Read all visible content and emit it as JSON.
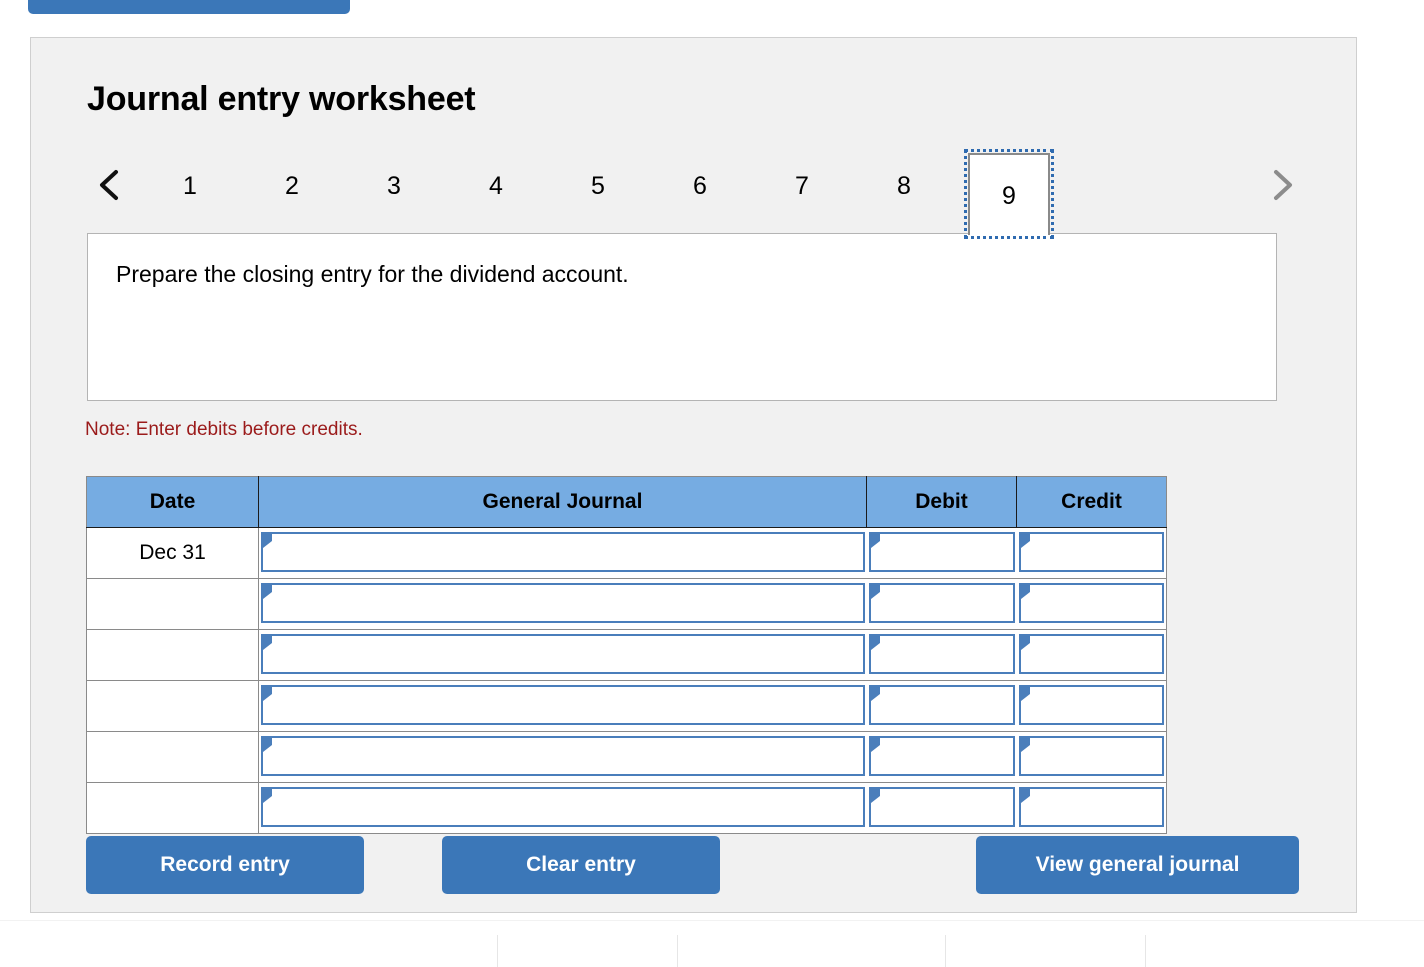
{
  "top_partial_button": {
    "name": "partial-blue-button",
    "color": "#3b77b8"
  },
  "worksheet": {
    "title": "Journal entry worksheet",
    "background": "#f1f1f1",
    "tabs": {
      "prev_icon": "chevron-left-icon",
      "next_icon": "chevron-right-icon",
      "prev_enabled": true,
      "next_enabled": false,
      "items": [
        {
          "label": "1",
          "selected": false
        },
        {
          "label": "2",
          "selected": false
        },
        {
          "label": "3",
          "selected": false
        },
        {
          "label": "4",
          "selected": false
        },
        {
          "label": "5",
          "selected": false
        },
        {
          "label": "6",
          "selected": false
        },
        {
          "label": "7",
          "selected": false
        },
        {
          "label": "8",
          "selected": false
        },
        {
          "label": "9",
          "selected": true
        }
      ],
      "selected_label": "9"
    },
    "instruction": "Prepare the closing entry for the dividend account.",
    "note": "Note: Enter debits before credits.",
    "note_color": "#9b1b1b",
    "table": {
      "header_color": "#76ace2",
      "headers": {
        "date": "Date",
        "general_journal": "General Journal",
        "debit": "Debit",
        "credit": "Credit"
      },
      "rows": [
        {
          "date": "Dec 31",
          "general_journal": "",
          "debit": "",
          "credit": ""
        },
        {
          "date": "",
          "general_journal": "",
          "debit": "",
          "credit": ""
        },
        {
          "date": "",
          "general_journal": "",
          "debit": "",
          "credit": ""
        },
        {
          "date": "",
          "general_journal": "",
          "debit": "",
          "credit": ""
        },
        {
          "date": "",
          "general_journal": "",
          "debit": "",
          "credit": ""
        },
        {
          "date": "",
          "general_journal": "",
          "debit": "",
          "credit": ""
        }
      ]
    },
    "buttons": {
      "record": "Record entry",
      "clear": "Clear entry",
      "view": "View general journal",
      "color": "#3b77b8"
    }
  }
}
